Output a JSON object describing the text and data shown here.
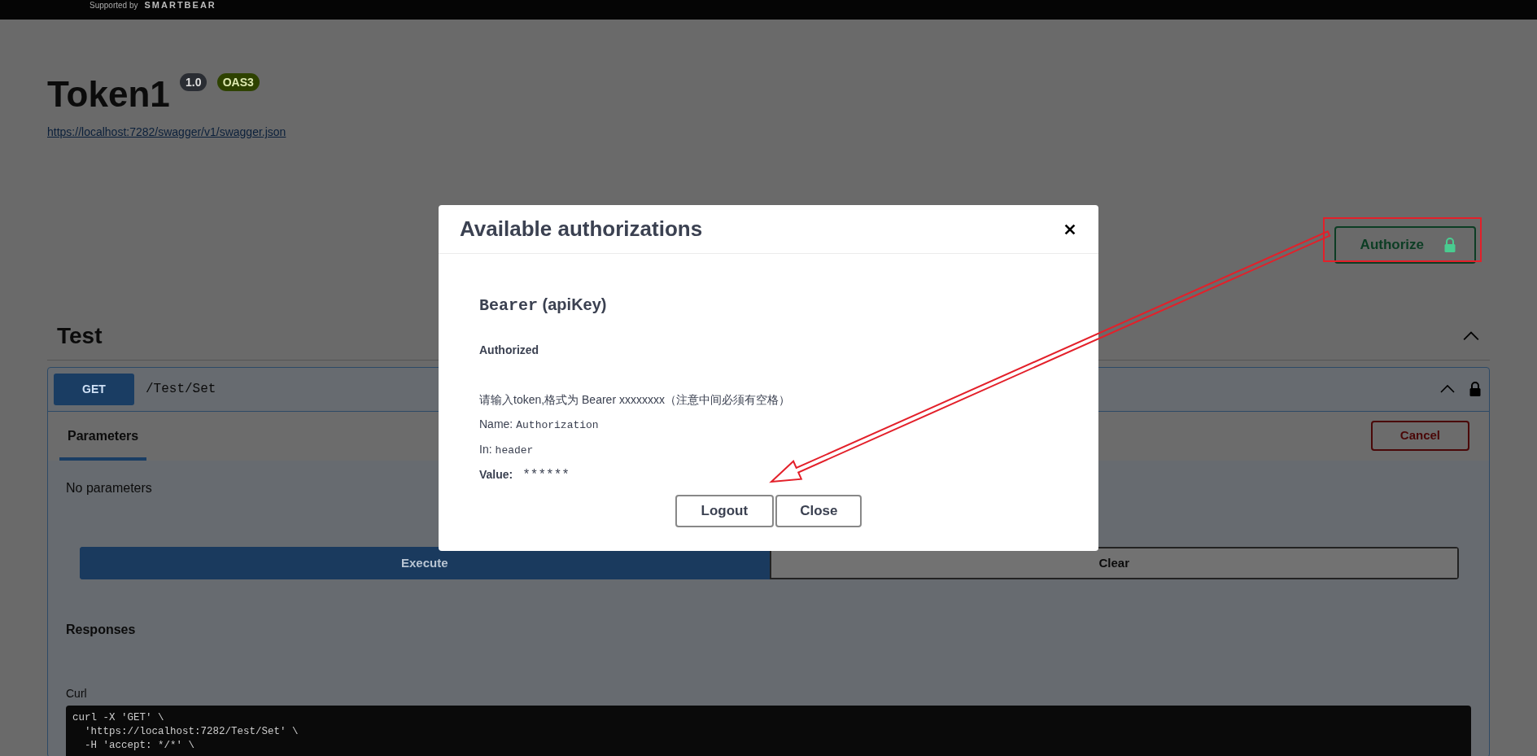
{
  "header": {
    "tagline": "Supported by",
    "brand": "SMARTBEAR"
  },
  "info": {
    "title": "Token1",
    "version": "1.0",
    "spec_badge": "OAS3",
    "spec_url": "https://localhost:7282/swagger/v1/swagger.json"
  },
  "authorize_button": {
    "label": "Authorize",
    "locked": true
  },
  "tag": {
    "name": "Test",
    "expanded": true,
    "operation": {
      "method": "GET",
      "path": "/Test/Set",
      "expanded": true,
      "locked": true,
      "tabs": [
        {
          "label": "Parameters",
          "selected": true
        }
      ],
      "cancel_label": "Cancel",
      "no_params": "No parameters",
      "buttons": [
        {
          "label": "Execute",
          "kind": "primary"
        },
        {
          "label": "Clear",
          "kind": "outline"
        }
      ],
      "responses_title": "Responses",
      "curl_label": "Curl",
      "curl_lines": [
        "curl -X 'GET' \\",
        "  'https://localhost:7282/Test/Set' \\",
        "  -H 'accept: */*' \\"
      ]
    }
  },
  "modal": {
    "title": "Available authorizations",
    "scheme": {
      "name": "Bearer",
      "type": "(apiKey)"
    },
    "status": "Authorized",
    "description": "请输入token,格式为 Bearer xxxxxxxx（注意中间必须有空格）",
    "fields": [
      {
        "label": "Name:",
        "value": "Authorization",
        "kind": "plain"
      },
      {
        "label": "In:",
        "value": "header",
        "kind": "plain"
      },
      {
        "label": "Value:",
        "value": "******",
        "kind": "strong"
      }
    ],
    "buttons": [
      "Logout",
      "Close"
    ]
  }
}
